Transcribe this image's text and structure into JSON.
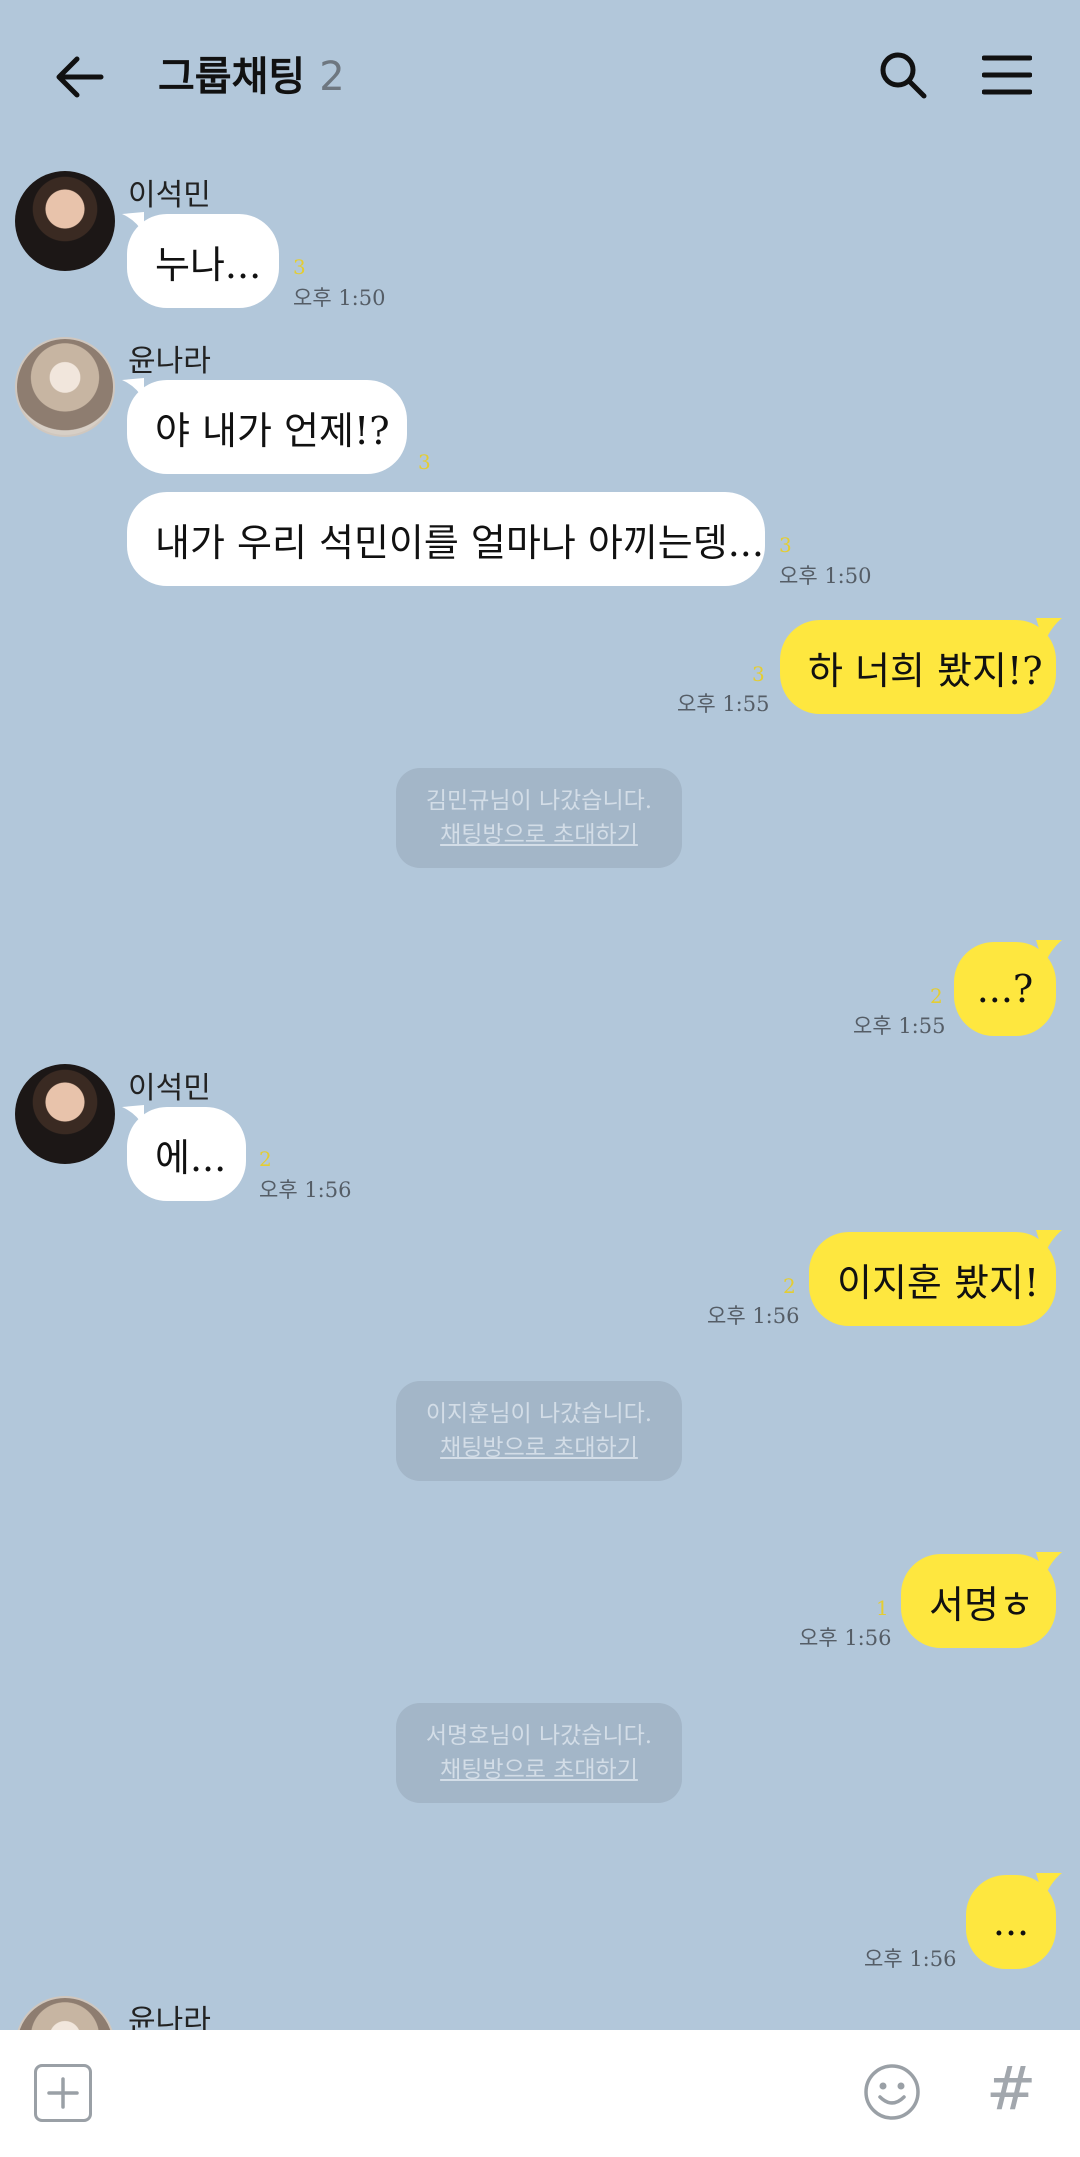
{
  "header": {
    "title": "그룹채팅",
    "member_count": "2"
  },
  "messages": {
    "m1": {
      "sender": "이석민",
      "text": "누나...",
      "unread": "3",
      "time": "오후 1:50"
    },
    "m2": {
      "sender": "윤나라",
      "text": "야 내가 언제!?",
      "unread": "3"
    },
    "m3": {
      "text": "내가 우리 석민이를 얼마나 아끼는뎅...",
      "unread": "3",
      "time": "오후 1:50"
    },
    "m4": {
      "text": "하 너희 봤지!?",
      "unread": "3",
      "time": "오후 1:55"
    },
    "sys1": {
      "text": "김민규님이 나갔습니다.",
      "invite": "채팅방으로 초대하기"
    },
    "m5": {
      "text": "...?",
      "unread": "2",
      "time": "오후 1:55"
    },
    "m6": {
      "sender": "이석민",
      "text": "에...",
      "unread": "2",
      "time": "오후 1:56"
    },
    "m7": {
      "text": "이지훈 봤지!",
      "unread": "2",
      "time": "오후 1:56"
    },
    "sys2": {
      "text": "이지훈님이 나갔습니다.",
      "invite": "채팅방으로 초대하기"
    },
    "m8": {
      "text": "서명ㅎ",
      "unread": "1",
      "time": "오후 1:56"
    },
    "sys3": {
      "text": "서명호님이 나갔습니다.",
      "invite": "채팅방으로 초대하기"
    },
    "m9": {
      "text": "...",
      "time": "오후 1:56"
    },
    "m10": {
      "sender": "윤나라"
    }
  },
  "colors": {
    "background": "#b2c7da",
    "my_bubble": "#fee73f",
    "other_bubble": "#ffffff",
    "unread_count": "#e4cd32"
  },
  "icons": {
    "back": "arrow-left-icon",
    "search": "search-icon",
    "menu": "hamburger-menu-icon",
    "add": "plus-icon",
    "emoji": "smiley-icon",
    "hashtag": "hash-icon"
  }
}
